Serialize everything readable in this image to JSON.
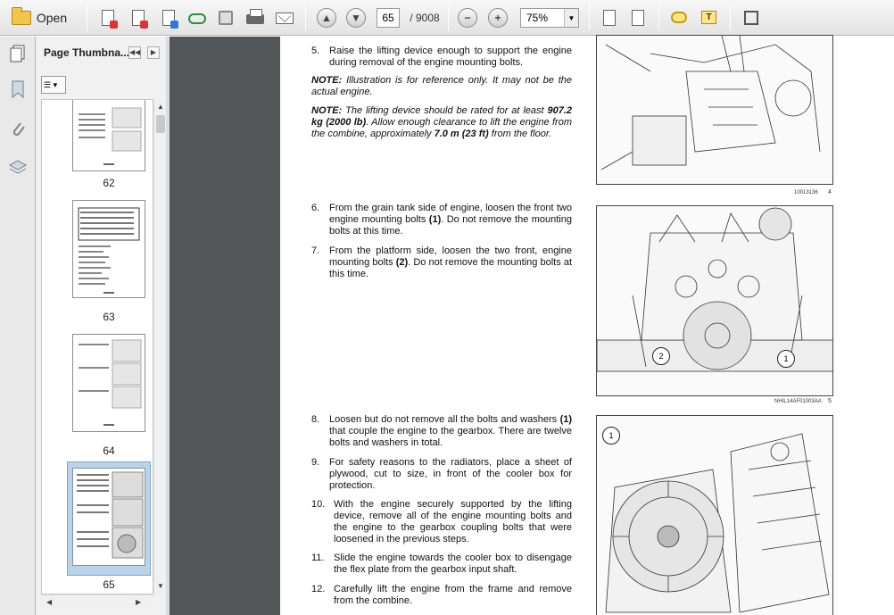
{
  "toolbar": {
    "open_label": "Open",
    "page_current": "65",
    "page_separator": "/",
    "page_total": "9008",
    "zoom": "75%"
  },
  "panel": {
    "title": "Page Thumbna...",
    "thumb_labels": [
      "62",
      "63",
      "64",
      "65"
    ]
  },
  "page": {
    "step5": {
      "num": "5.",
      "text": "Raise the lifting device enough to support the engine during removal of the engine mounting bolts."
    },
    "note1": {
      "label": "NOTE:",
      "text": "Illustration is for reference only. It may not be the actual engine."
    },
    "note2": {
      "label": "NOTE:",
      "text_a": "The lifting device should be rated for at least",
      "bold_a": "907.2 kg (2000 lb)",
      "text_b": ". Allow enough clearance to lift the engine from the combine, approximately",
      "bold_b": "7.0 m (23 ft)",
      "text_c": "from the floor."
    },
    "step6": {
      "num": "6.",
      "text_a": "From the grain tank side of engine, loosen the front two engine mounting bolts",
      "bold": "(1)",
      "text_b": ". Do not remove the mounting bolts at this time."
    },
    "step7": {
      "num": "7.",
      "text_a": "From the platform side, loosen the two front, engine mounting bolts",
      "bold": "(2)",
      "text_b": ". Do not remove the mounting bolts at this time."
    },
    "step8": {
      "num": "8.",
      "text_a": "Loosen but do not remove all the bolts and washers",
      "bold": "(1)",
      "text_b": "that couple the engine to the gearbox. There are twelve bolts and washers in total."
    },
    "step9": {
      "num": "9.",
      "text": "For safety reasons to the radiators, place a sheet of plywood, cut to size, in front of the cooler box for protection."
    },
    "step10": {
      "num": "10.",
      "text": "With the engine securely supported by the lifting device, remove all of the engine mounting bolts and the engine to the gearbox coupling bolts that were loosened in the previous steps."
    },
    "step11": {
      "num": "11.",
      "text": "Slide the engine towards the cooler box to disengage the flex plate from the gearbox input shaft."
    },
    "step12": {
      "num": "12.",
      "text": "Carefully lift the engine from the frame and remove from the combine."
    },
    "fig1_caption": "10013136",
    "fig1_num": "4",
    "fig2_caption": "NHIL14AF01003AA",
    "fig2_num": "5",
    "callout1": "1",
    "callout2": "2",
    "callout3": "1"
  }
}
